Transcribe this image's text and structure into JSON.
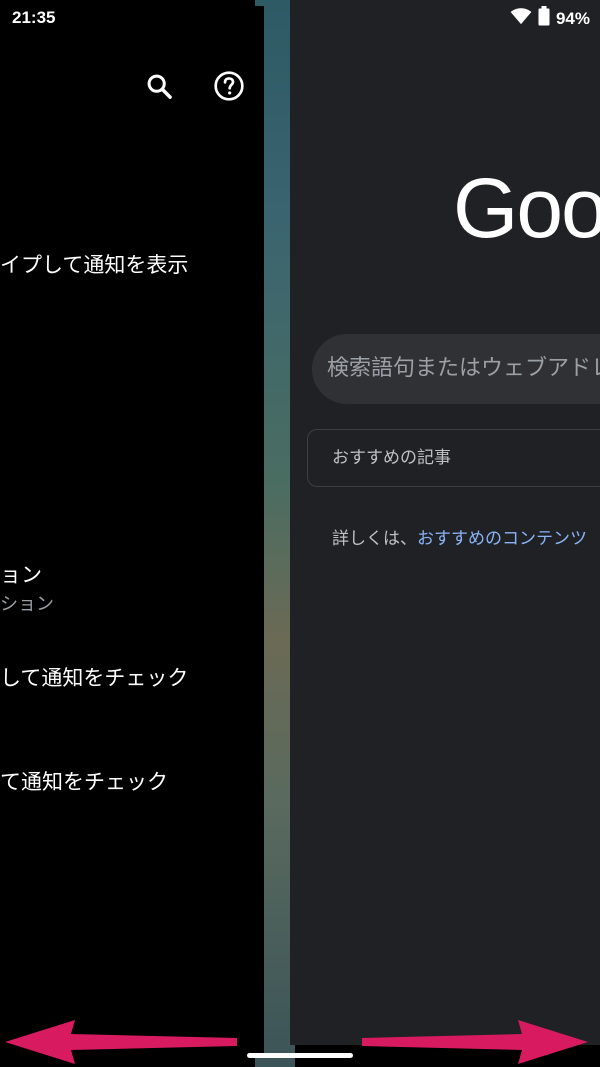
{
  "status_bar": {
    "time": "21:35",
    "battery": "94%",
    "icons": [
      "wifi-icon",
      "battery-icon"
    ]
  },
  "settings_card": {
    "toolbar_icons": [
      "search-icon",
      "help-icon"
    ],
    "rows": [
      {
        "label": "イプして通知を表示"
      },
      {
        "label": "ョン",
        "sub": "ション"
      },
      {
        "label": "して通知をチェック"
      },
      {
        "label": "て通知をチェック"
      }
    ]
  },
  "browser_card": {
    "logo": "Goo",
    "search_placeholder": "検索語句またはウェブアドレ",
    "recommended_box": "おすすめの記事",
    "detail_prefix": "詳しくは、",
    "detail_link": "おすすめのコンテンツ"
  },
  "gesture": {
    "arrows": [
      "swipe-left-arrow",
      "swipe-right-arrow"
    ],
    "arrow_color": "#d81b60"
  },
  "colors": {
    "browser_bg": "#202124",
    "link": "#8ab4f8",
    "search_pill": "#303134"
  }
}
